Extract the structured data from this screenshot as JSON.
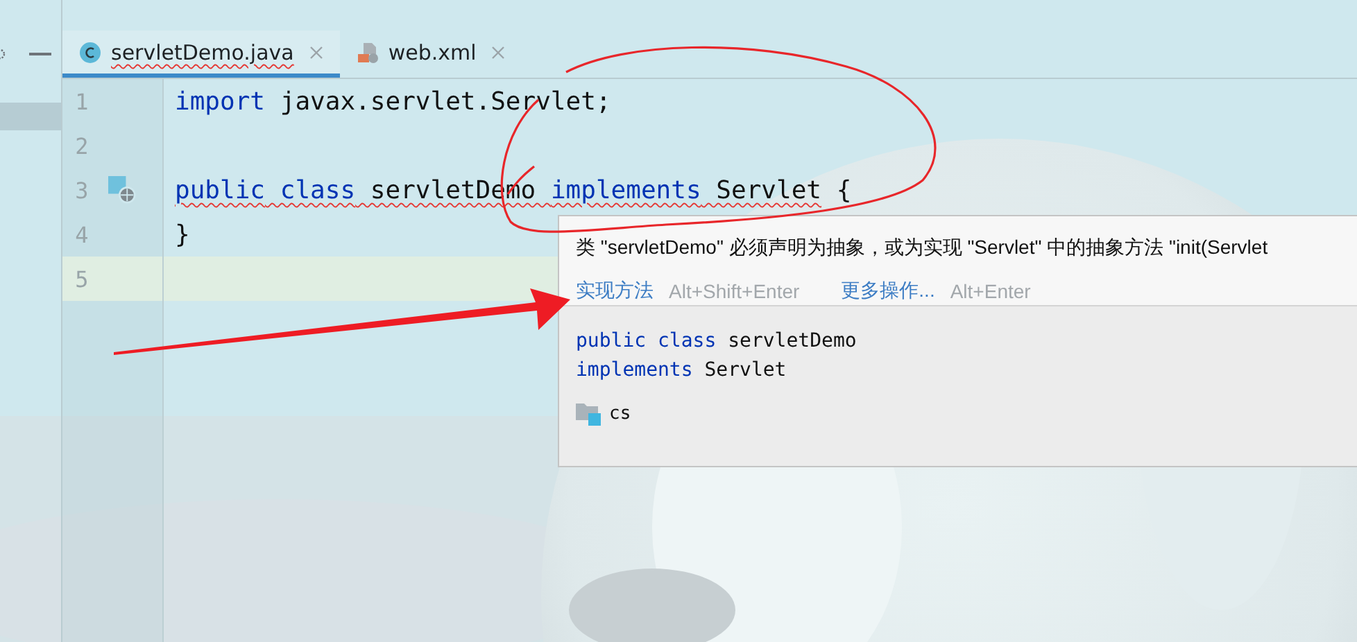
{
  "tabs": [
    {
      "label": "servletDemo.java",
      "selected": true,
      "error": true
    },
    {
      "label": "web.xml",
      "selected": false,
      "error": false
    }
  ],
  "editor": {
    "lines": [
      {
        "number": "1",
        "current": false,
        "gutter_icon": false,
        "tokens": [
          {
            "text": "import",
            "kind": "keyword",
            "error": false
          },
          {
            "text": " javax.servlet.Servlet;",
            "kind": "plain",
            "error": false
          }
        ]
      },
      {
        "number": "2",
        "current": false,
        "gutter_icon": false
      },
      {
        "number": "3",
        "current": false,
        "gutter_icon": true,
        "tokens": [
          {
            "text": "public",
            "kind": "keyword",
            "error": true
          },
          {
            "text": " class",
            "kind": "keyword",
            "error": true
          },
          {
            "text": " servletDemo ",
            "kind": "plain",
            "error": true
          },
          {
            "text": "implements",
            "kind": "keyword",
            "error": true
          },
          {
            "text": " Servlet",
            "kind": "plain",
            "error": true
          },
          {
            "text": " {",
            "kind": "plain",
            "error": false
          }
        ]
      },
      {
        "number": "4",
        "current": false,
        "gutter_icon": false,
        "tokens": [
          {
            "text": "}",
            "kind": "plain",
            "error": false
          }
        ]
      },
      {
        "number": "5",
        "current": true,
        "gutter_icon": false
      }
    ]
  },
  "popup": {
    "message": "类 \"servletDemo\" 必须声明为抽象，或为实现 \"Servlet\" 中的抽象方法 \"init(Servlet",
    "actions": [
      {
        "label": "实现方法",
        "shortcut": "Alt+Shift+Enter"
      },
      {
        "label": "更多操作...",
        "shortcut": "Alt+Enter"
      }
    ],
    "declaration": [
      [
        {
          "text": "public",
          "kind": "keyword"
        },
        {
          "text": " class",
          "kind": "keyword"
        },
        {
          "text": " servletDemo",
          "kind": "plain"
        }
      ],
      [
        {
          "text": "implements",
          "kind": "keyword"
        },
        {
          "text": " Servlet",
          "kind": "plain"
        }
      ]
    ],
    "module": "cs"
  }
}
